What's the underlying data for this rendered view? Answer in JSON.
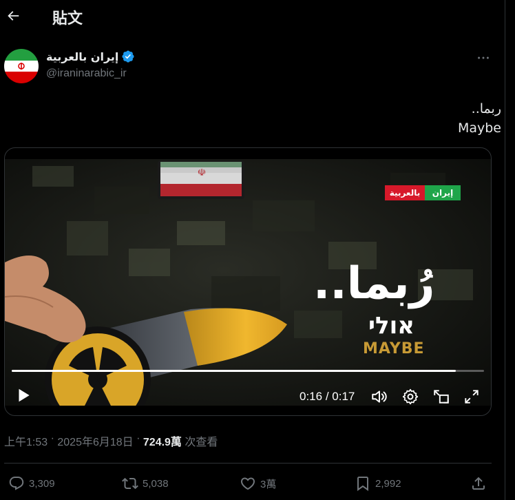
{
  "header": {
    "title": "貼文"
  },
  "author": {
    "display_name": "إيران بالعربية",
    "handle": "@iraninarabic_ir"
  },
  "tweet": {
    "text_line1": "ربما..",
    "text_line2": "Maybe"
  },
  "video": {
    "overlay_ar": "رُبما..",
    "overlay_he": "אולי",
    "overlay_en": "MAYBE",
    "channel_logo_left": "بالعربية",
    "channel_logo_right": "إيران",
    "current_time": "0:16",
    "separator": "/",
    "duration": "0:17",
    "progress_fraction": 0.94
  },
  "meta": {
    "time": "上午1:53",
    "date": "2025年6月18日",
    "views_count": "724.9萬",
    "views_label": "次查看"
  },
  "actions": {
    "replies": "3,309",
    "reposts": "5,038",
    "likes": "3萬",
    "bookmarks": "2,992"
  },
  "colors": {
    "background": "#000000",
    "text_primary": "#e7e9ea",
    "text_secondary": "#71767b",
    "verified": "#1d9bf0",
    "border": "#2f3336"
  }
}
